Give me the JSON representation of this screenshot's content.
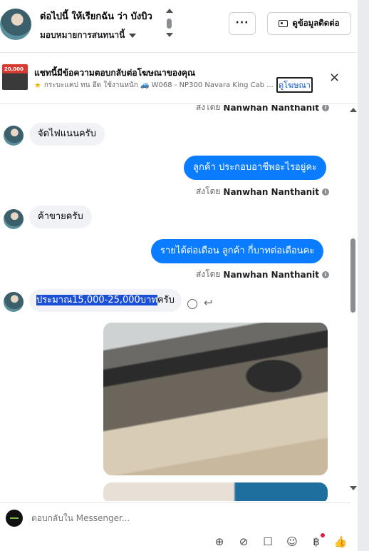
{
  "header": {
    "contact_name": "ต่อไปนี้ ให้เรียกฉัน ว่า บังบิว",
    "assign_label": "มอบหมายการสนทนานี้",
    "more_label": "···",
    "contact_info_label": "ดูข้อมูลติดต่อ"
  },
  "ad_banner": {
    "thumb_text": "20,000",
    "title": "แชทนี้มีข้อความตอบกลับต่อโฆษณาของคุณ",
    "detail": "กระบะแคป ทน อึด ใช้งานหนัก 🚙 W068 - NP300 Navara King Cab ...",
    "link_label": "ดูโฆษณา",
    "close_label": "×"
  },
  "messages": {
    "sent_by_prefix": "ส่งโดย",
    "agent_name": "Nanwhan Nanthanit",
    "m1": "จัดไฟแนนครับ",
    "m2": "ลูกค้า ประกอบอาชีพอะไรอยู่คะ",
    "m3": "ค้าขายครับ",
    "m4": "รายได้ต่อเดือน ลูกค้า กี่บาทต่อเดือนคะ",
    "m5_highlight": "ประมาณ15,000-25,000บาท",
    "m5_rest": "ครับ"
  },
  "composer": {
    "placeholder": "ตอบกลับใน Messenger..."
  },
  "icons": {
    "tools": [
      "add-contact-icon",
      "attachment-icon",
      "saved-reply-icon",
      "emoji-icon",
      "payment-icon",
      "like-icon"
    ]
  },
  "colors": {
    "outgoing_bubble": "#0a7cff",
    "incoming_bubble": "#f0f2f5",
    "link": "#0a56c2"
  }
}
